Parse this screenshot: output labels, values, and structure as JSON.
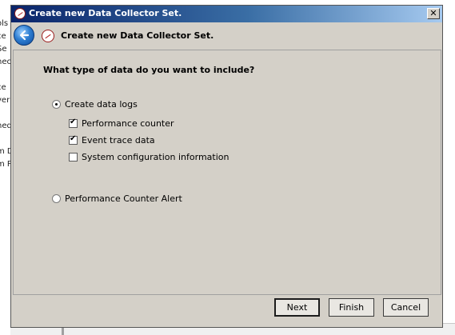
{
  "background_window": {
    "fragments": [
      "ols",
      "ce",
      "Se",
      "nec",
      "ce",
      "ver",
      "ned",
      "m D",
      "m P"
    ]
  },
  "window": {
    "title": "Create new Data Collector Set.",
    "close_label": "✕"
  },
  "wizard": {
    "header_title": "Create new Data Collector Set.",
    "question": "What type of data do you want to include?",
    "options": {
      "create_logs": {
        "label": "Create data logs",
        "selected": true
      },
      "performance_counter": {
        "label": "Performance counter",
        "checked": true
      },
      "event_trace": {
        "label": "Event trace data",
        "checked": true
      },
      "system_config": {
        "label": "System configuration information",
        "checked": false
      },
      "counter_alert": {
        "label": "Performance Counter Alert",
        "selected": false
      }
    }
  },
  "buttons": {
    "next": "Next",
    "finish": "Finish",
    "cancel": "Cancel"
  },
  "colors": {
    "dialog_bg": "#d4d0c8",
    "titlebar_start": "#0a246a",
    "titlebar_end": "#a6caf0"
  }
}
